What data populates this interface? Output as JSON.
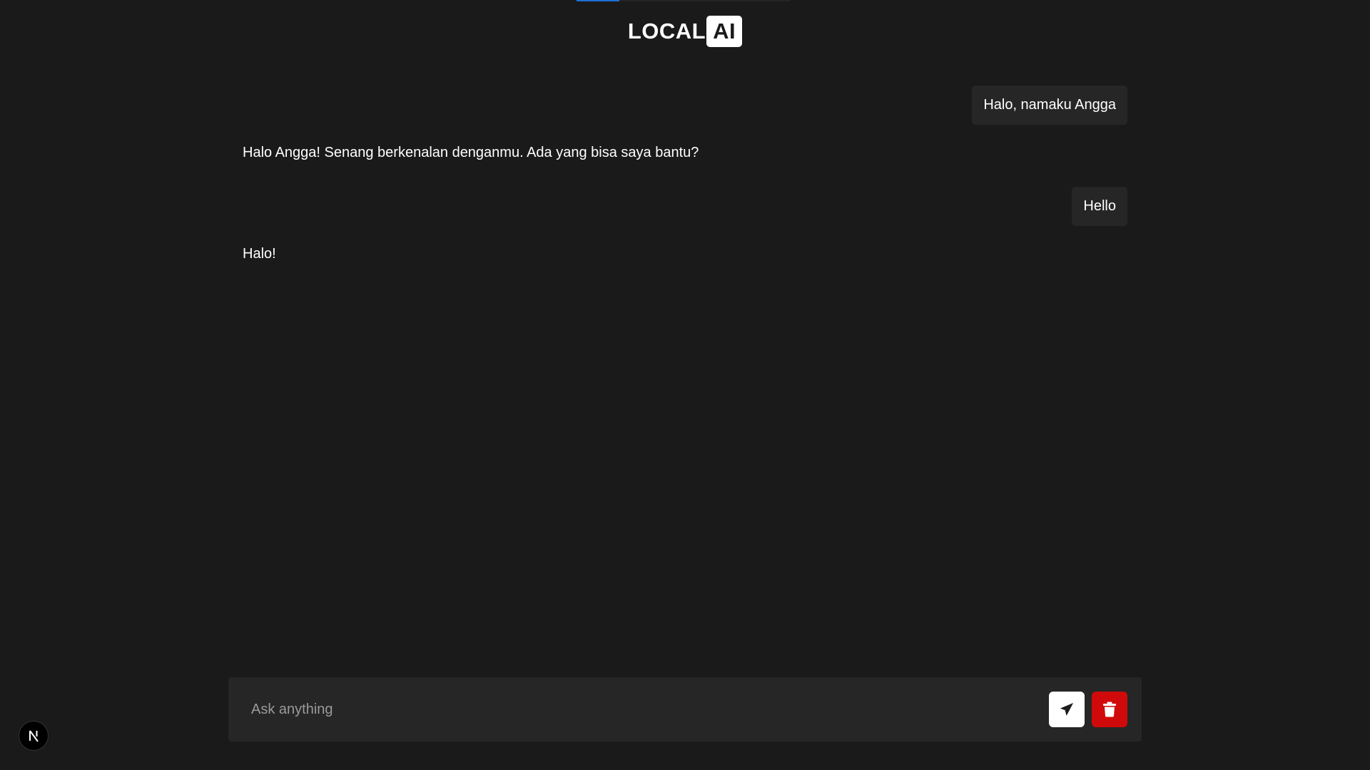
{
  "header": {
    "logo_part1": "LOCAL",
    "logo_part2": "AI"
  },
  "loading_bar": {
    "progress_fraction": 0.2,
    "color": "#1f6fd6"
  },
  "messages": [
    {
      "role": "user",
      "text": "Halo, namaku Angga"
    },
    {
      "role": "assistant",
      "text": "Halo Angga! Senang berkenalan denganmu. Ada yang bisa saya bantu?"
    },
    {
      "role": "user",
      "text": "Hello"
    },
    {
      "role": "assistant",
      "text": "Halo!"
    }
  ],
  "composer": {
    "placeholder": "Ask anything",
    "value": "",
    "send_icon": "paper-plane-icon",
    "clear_icon": "trash-icon"
  },
  "dev_badge": {
    "icon": "nextjs-n-icon"
  },
  "colors": {
    "background": "#1a1a1a",
    "panel": "#262626",
    "danger": "#d00a0a"
  }
}
